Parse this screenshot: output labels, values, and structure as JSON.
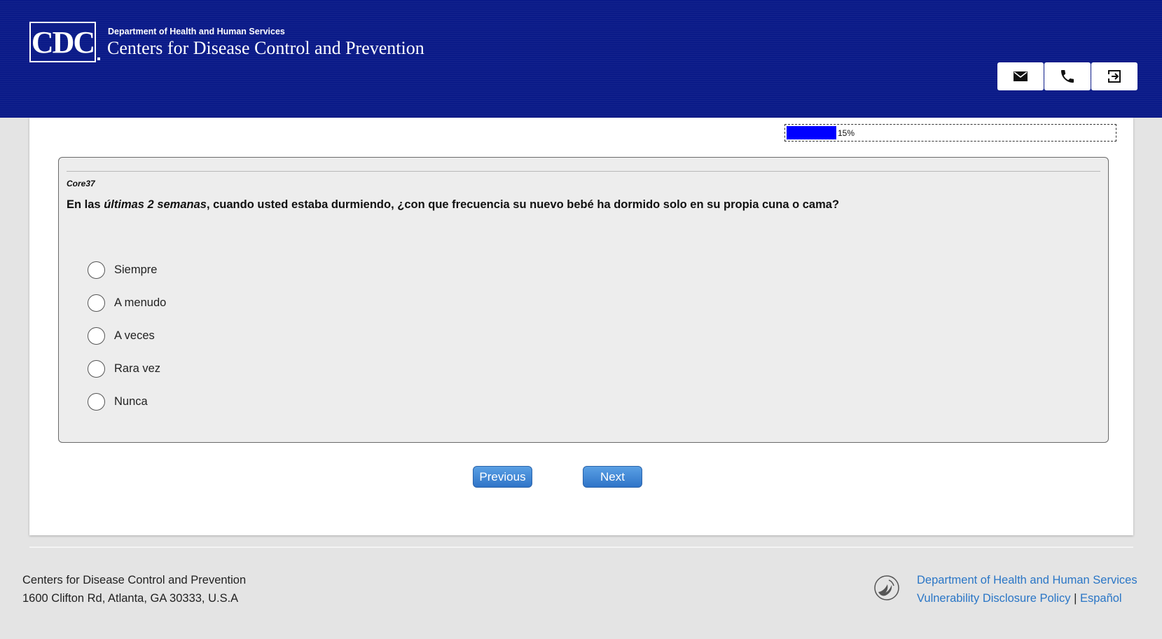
{
  "header": {
    "logo_text": "CDC",
    "department": "Department of Health and Human Services",
    "agency": "Centers for Disease Control and Prevention",
    "buttons": [
      {
        "name": "email-button",
        "icon": "envelope-icon"
      },
      {
        "name": "phone-button",
        "icon": "phone-icon"
      },
      {
        "name": "exit-button",
        "icon": "exit-icon"
      }
    ]
  },
  "progress": {
    "percent": 15,
    "label": "15%"
  },
  "question": {
    "id": "Core37",
    "text_before": "En las ",
    "text_emphasis": "últimas 2 semanas",
    "text_after": ", cuando usted estaba durmiendo, ¿con que frecuencia su nuevo bebé ha dormido solo en su propia cuna o cama?",
    "options": [
      "Siempre",
      "A menudo",
      "A veces",
      "Rara vez",
      "Nunca"
    ]
  },
  "navigation": {
    "previous_label": "Previous",
    "next_label": "Next"
  },
  "footer": {
    "org_name": "Centers for Disease Control and Prevention",
    "address": "1600 Clifton Rd, Atlanta, GA 30333, U.S.A",
    "links": {
      "hhs": "Department of Health and Human Services",
      "vdp": "Vulnerability Disclosure Policy",
      "separator": "|",
      "espanol": "Español"
    }
  },
  "colors": {
    "header_bg": "#0a1a88",
    "progress_fill": "#0000ff",
    "button_blue": "#3a80d0",
    "link_blue": "#2a76c6"
  }
}
